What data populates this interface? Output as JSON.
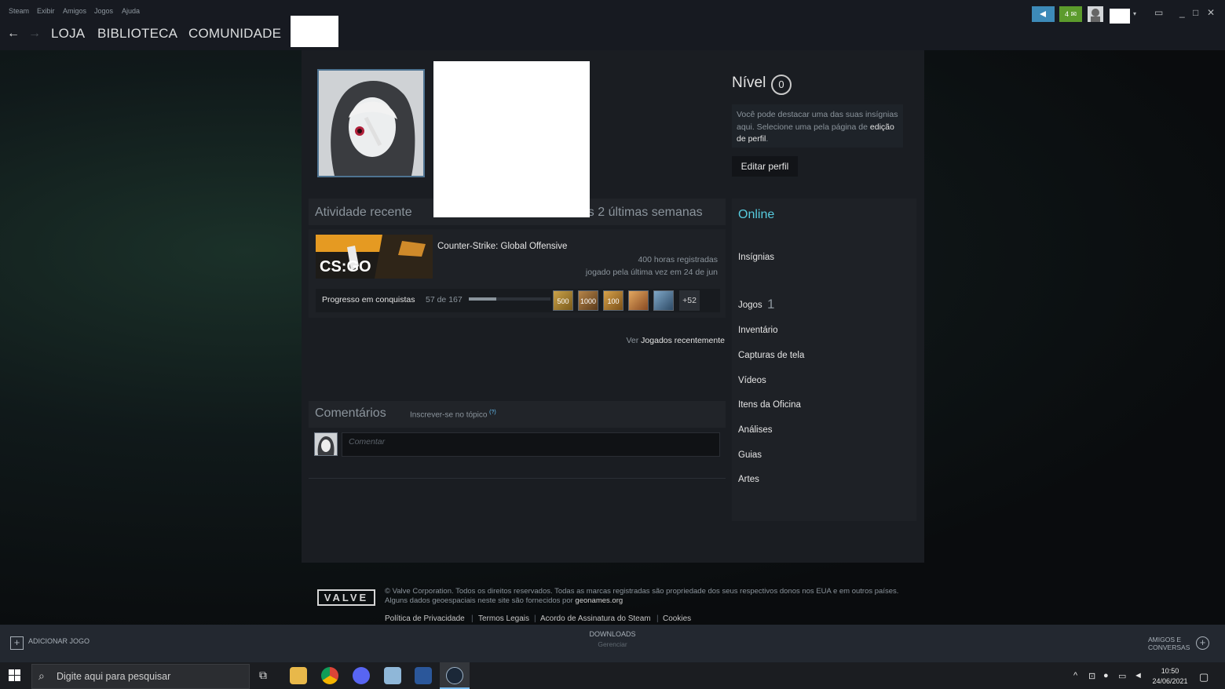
{
  "menu": {
    "steam": "Steam",
    "view": "Exibir",
    "friends": "Amigos",
    "games": "Jogos",
    "help": "Ajuda"
  },
  "nav": {
    "back": "←",
    "forward": "→",
    "store": "LOJA",
    "library": "BIBLIOTECA",
    "community": "COMUNIDADE"
  },
  "titlebar": {
    "badge_count": "4 ✉"
  },
  "profile": {
    "level_label": "Nível",
    "level": "0",
    "badge_hint_1": "Você pode destacar uma das suas insígnias aqui. Selecione uma pela página de ",
    "badge_hint_link": "edição de perfil",
    "badge_hint_end": ".",
    "edit_button": "Editar perfil"
  },
  "activity": {
    "title": "Atividade recente",
    "hours_header": "has 2 últimas semanas",
    "game_name": "Counter-Strike: Global Offensive",
    "game_logo": "CS:GO",
    "hours": "400 horas registradas",
    "last_played": "jogado pela última vez em 24 de jun",
    "ach_label": "Progresso em conquistas",
    "ach_count": "57 de 167",
    "ach_progress": 0.34,
    "ach_icons": [
      "500",
      "1000",
      "100",
      "",
      "",
      ""
    ],
    "ach_more": "+52",
    "see_prefix": "Ver ",
    "see_link": "Jogados recentemente"
  },
  "comments": {
    "title": "Comentários",
    "subscribe": "Inscrever-se no tópico",
    "help": "(?)",
    "placeholder": "Comentar"
  },
  "sidebar": {
    "status": "Online",
    "items": [
      "Insígnias",
      "Jogos",
      "Inventário",
      "Capturas de tela",
      "Vídeos",
      "Itens da Oficina",
      "Análises",
      "Guias",
      "Artes"
    ],
    "games_count": "1"
  },
  "footer": {
    "logo": "VALVE",
    "copy": "© Valve Corporation. Todos os direitos reservados. Todas as marcas registradas são propriedade dos seus respectivos donos nos EUA e em outros países. Alguns dados geoespaciais neste site são fornecidos por ",
    "copy_link": "geonames.org",
    "links": [
      "Política de Privacidade",
      "Termos Legais",
      "Acordo de Assinatura do Steam",
      "Cookies"
    ]
  },
  "bottom": {
    "add_game": "ADICIONAR JOGO",
    "downloads": "DOWNLOADS",
    "manage": "Gerenciar",
    "friends_1": "AMIGOS E",
    "friends_2": "CONVERSAS"
  },
  "taskbar": {
    "search_placeholder": "Digite aqui para pesquisar",
    "time": "10:50",
    "date": "24/06/2021"
  },
  "colors": {
    "accent_online": "#57cbde",
    "titlebar": "#171a21",
    "link_blue": "#66c0f4"
  }
}
